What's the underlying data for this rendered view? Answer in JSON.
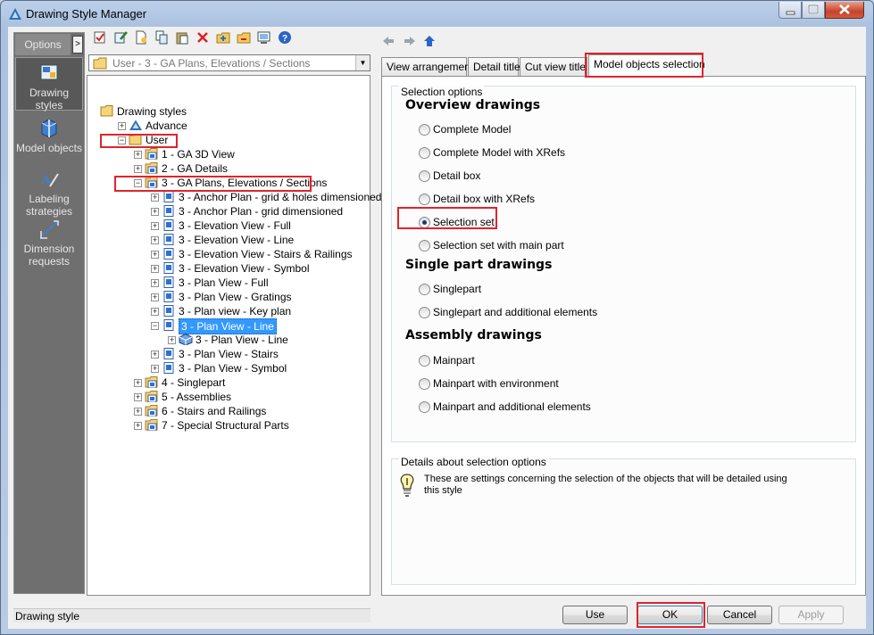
{
  "window": {
    "title": "Drawing Style Manager"
  },
  "nav": {
    "options_label": "Options",
    "options_arrow": ">",
    "items": [
      {
        "label": "Drawing styles",
        "icon": "drawing-styles-icon",
        "selected": true
      },
      {
        "label": "Model objects",
        "icon": "model-objects-icon"
      },
      {
        "label": "Labeling strategies",
        "icon": "labeling-strategies-icon"
      },
      {
        "label": "Dimension requests",
        "icon": "dimension-requests-icon"
      }
    ]
  },
  "tree_combo": {
    "value": "User - 3 - GA Plans, Elevations / Sections"
  },
  "tree": {
    "root": "Drawing styles",
    "advance": "Advance",
    "user": "User",
    "ga3d": "1 - GA 3D View",
    "gadetails": "2 - GA Details",
    "gaplans": "3 - GA Plans, Elevations / Sections",
    "children": [
      "3 - Anchor Plan - grid & holes dimensioned",
      "3 - Anchor Plan - grid dimensioned",
      "3 - Elevation View - Full",
      "3 - Elevation View - Line",
      "3 - Elevation View - Stairs & Railings",
      "3 - Elevation View - Symbol",
      "3 - Plan View - Full",
      "3 - Plan View - Gratings",
      "3 - Plan view - Key plan",
      "3 - Plan View - Line"
    ],
    "grandchild": "3 - Plan View - Line",
    "children_after": [
      "3 - Plan View - Stairs",
      "3 - Plan View - Symbol"
    ],
    "tail": [
      "4 - Singlepart",
      "5 - Assemblies",
      "6 - Stairs and Railings",
      "7 - Special Structural Parts"
    ]
  },
  "tabs": [
    "View arrangement",
    "Detail title",
    "Cut view title",
    "Model objects selection"
  ],
  "active_tab": "Model objects selection",
  "selection": {
    "caption": "Selection options",
    "overview_h": "Overview drawings",
    "overview": [
      "Complete Model",
      "Complete Model with XRefs",
      "Detail box",
      "Detail box with XRefs",
      "Selection set",
      "Selection set with main part"
    ],
    "selected": "Selection set",
    "single_h": "Single part drawings",
    "single": [
      "Singlepart",
      "Singlepart and additional elements"
    ],
    "assembly_h": "Assembly drawings",
    "assembly": [
      "Mainpart",
      "Mainpart with environment",
      "Mainpart and additional elements"
    ]
  },
  "details": {
    "caption": "Details about selection options",
    "text": "These are settings concerning the selection of the objects that will be detailed using this style"
  },
  "status": {
    "text": "Drawing style"
  },
  "buttons": {
    "use": "Use",
    "ok": "OK",
    "cancel": "Cancel",
    "apply": "Apply"
  },
  "colors": {
    "highlight": "#e0242c",
    "selection": "#3399ff"
  }
}
